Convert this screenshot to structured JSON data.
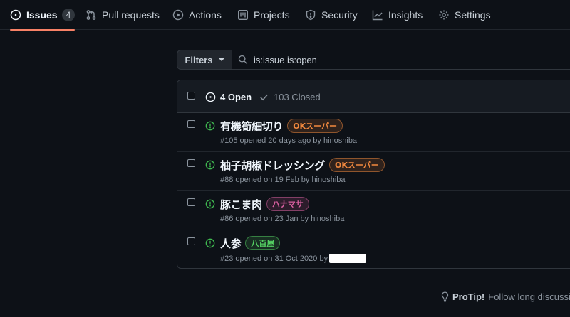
{
  "nav": {
    "tabs": [
      {
        "label": "Issues",
        "icon": "issue-opened-icon",
        "counter": "4",
        "active": true
      },
      {
        "label": "Pull requests",
        "icon": "git-pull-request-icon"
      },
      {
        "label": "Actions",
        "icon": "play-icon"
      },
      {
        "label": "Projects",
        "icon": "project-icon"
      },
      {
        "label": "Security",
        "icon": "shield-icon"
      },
      {
        "label": "Insights",
        "icon": "graph-icon"
      },
      {
        "label": "Settings",
        "icon": "gear-icon"
      }
    ]
  },
  "filters": {
    "button_label": "Filters",
    "search_value": "is:issue is:open"
  },
  "issues_header": {
    "open_label": "4 Open",
    "closed_label": "103 Closed"
  },
  "issues": [
    {
      "title": "有機筍細切り",
      "label": "OKスーパー",
      "label_color": "#f0883e",
      "meta": "#105 opened 20 days ago by hinoshiba"
    },
    {
      "title": "柚子胡椒ドレッシング",
      "label": "OKスーパー",
      "label_color": "#f0883e",
      "meta": "#88 opened on 19 Feb by hinoshiba"
    },
    {
      "title": "豚こま肉",
      "label": "ハナマサ",
      "label_color": "#db61a2",
      "meta": "#86 opened on 23 Jan by hinoshiba"
    },
    {
      "title": "人参",
      "label": "八百屋",
      "label_color": "#56d364",
      "meta": "#23 opened on 31 Oct 2020 by"
    }
  ],
  "protip": {
    "bold": "ProTip!",
    "text": "Follow long discussion"
  },
  "colors": {
    "background": "#0d1117",
    "accent_tab": "#f78166",
    "open_icon": "#3fb950"
  }
}
